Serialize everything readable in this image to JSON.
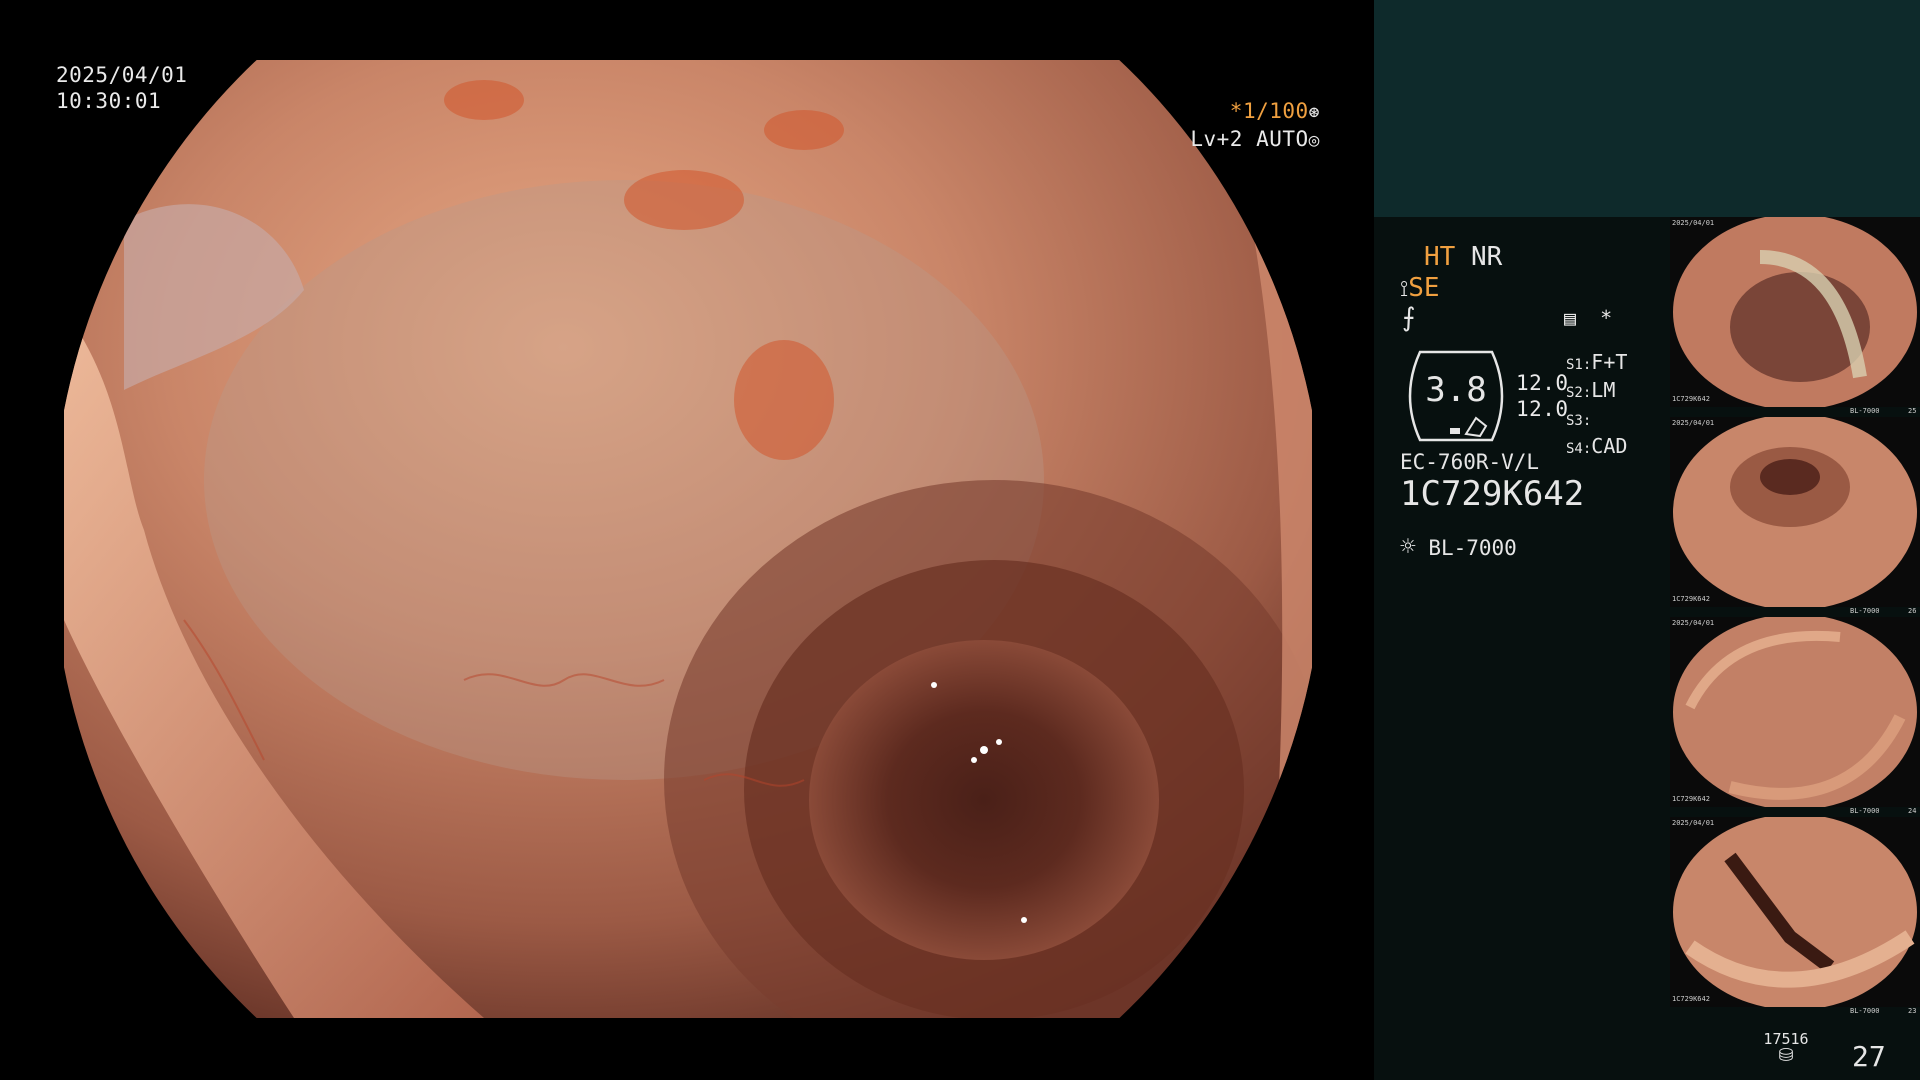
{
  "header": {
    "date": "2025/04/01",
    "time": "10:30:01"
  },
  "overlay": {
    "shutter": "*1/100",
    "level": "Lv+2 AUTO"
  },
  "status": {
    "ht": "HT",
    "nr": "NR",
    "se": "SE",
    "asterisk": "*"
  },
  "gauge": {
    "value": "3.8"
  },
  "scope_settings": {
    "values": [
      "12.0",
      "12.0"
    ],
    "s_labels": [
      "S1:",
      "S2:",
      "S3:",
      "S4:"
    ],
    "s_values": [
      "F+T",
      "LM",
      "",
      "CAD"
    ]
  },
  "device": {
    "model": "EC-760R-V/L",
    "serial": "1C729K642",
    "light_source": "BL-7000"
  },
  "thumbnails": [
    {
      "caption_top": "2025/04/01",
      "caption_serial": "1C729K642",
      "caption_light": "BL-7000",
      "caption_num": "25"
    },
    {
      "caption_top": "2025/04/01",
      "caption_serial": "1C729K642",
      "caption_light": "BL-7000",
      "caption_num": "26"
    },
    {
      "caption_top": "2025/04/01",
      "caption_serial": "1C729K642",
      "caption_light": "BL-7000",
      "caption_num": "24"
    },
    {
      "caption_top": "2025/04/01",
      "caption_serial": "1C729K642",
      "caption_light": "BL-7000",
      "caption_num": "23"
    }
  ],
  "footer": {
    "storage_count": "17516",
    "image_count": "27"
  },
  "colors": {
    "panel_top": "#0e2a2b",
    "panel_bottom": "#07100f",
    "accent_orange": "#f0a040",
    "tissue": "#c9795a"
  }
}
